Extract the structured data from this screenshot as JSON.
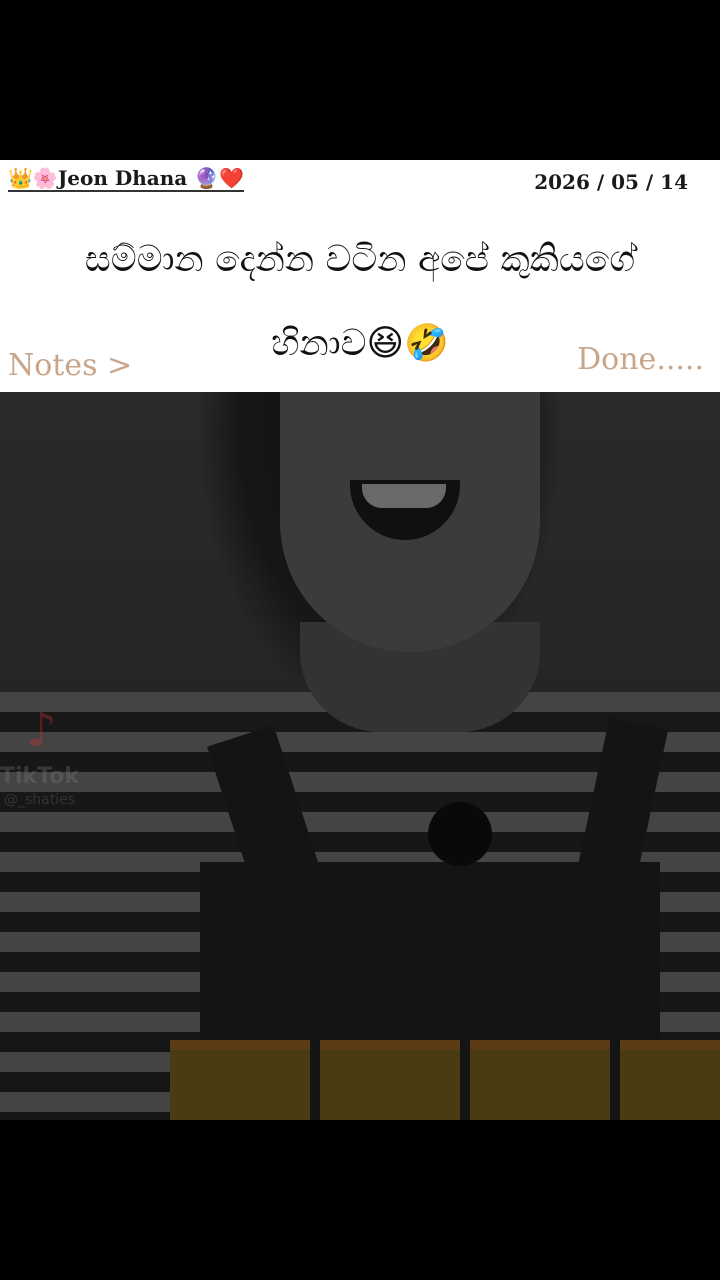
{
  "note": {
    "author_prefix_emoji": "👑🌸",
    "author_name": "Jeon Dhana",
    "author_suffix_emoji": "🔮❤️",
    "date": "2026 / 05 / 14",
    "caption_line1": "සම්මාන දෙන්න වටින අපේ කුකියගේ",
    "caption_line2": "හිනාව😆🤣",
    "notes_link": "Notes >",
    "done_label": "Done....."
  },
  "video": {
    "watermark_brand": "TikTok",
    "watermark_user": "@_shaties"
  },
  "colors": {
    "accent": "#c9a58a",
    "card_background": "#ffffff",
    "frame_background": "#000000"
  }
}
